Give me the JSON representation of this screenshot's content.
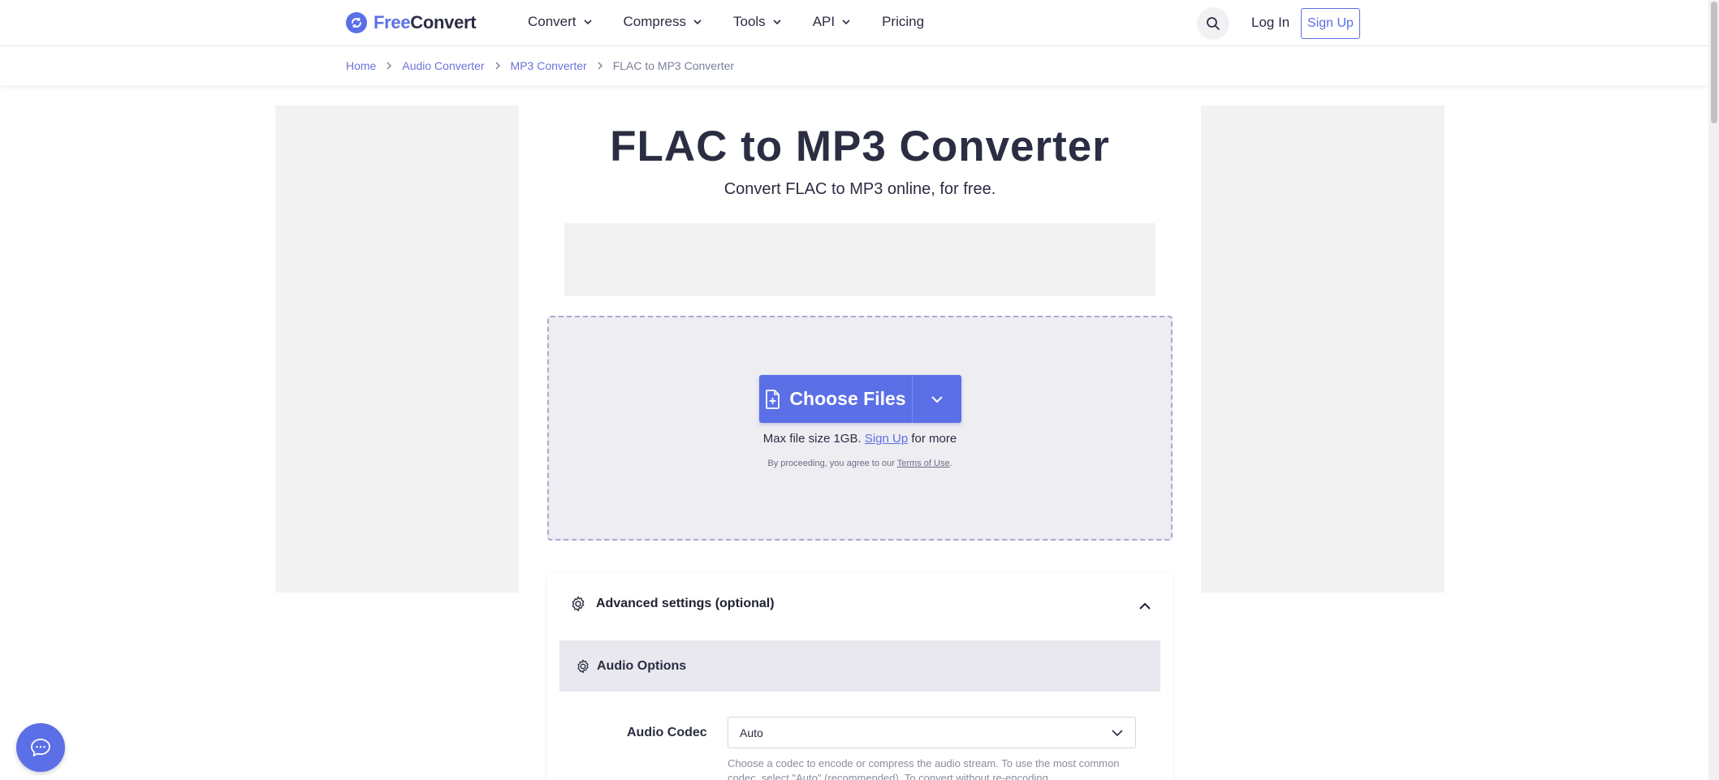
{
  "header": {
    "logo": {
      "part1": "Free",
      "part2": "Convert"
    },
    "nav": [
      {
        "label": "Convert",
        "has_dropdown": true
      },
      {
        "label": "Compress",
        "has_dropdown": true
      },
      {
        "label": "Tools",
        "has_dropdown": true
      },
      {
        "label": "API",
        "has_dropdown": true
      },
      {
        "label": "Pricing",
        "has_dropdown": false
      }
    ],
    "login_label": "Log In",
    "signup_label": "Sign Up"
  },
  "breadcrumb": [
    "Home",
    "Audio Converter",
    "MP3 Converter",
    "FLAC to MP3 Converter"
  ],
  "main": {
    "title": "FLAC to MP3 Converter",
    "subtitle": "Convert FLAC to MP3 online, for free."
  },
  "upload": {
    "choose_label": "Choose Files",
    "max_text": "Max file size 1GB.",
    "signup_link": "Sign Up",
    "max_suffix": "for more",
    "terms_prefix": "By proceeding, you agree to our",
    "terms_link": "Terms of Use",
    "terms_suffix": "."
  },
  "advanced": {
    "title": "Advanced settings (optional)",
    "section": "Audio Options",
    "codec_label": "Audio Codec",
    "codec_value": "Auto",
    "codec_help": "Choose a codec to encode or compress the audio stream. To use the most common codec, select \"Auto\" (recommended). To convert without re-encoding"
  },
  "colors": {
    "brand": "#5b6fe6",
    "text": "#2b2d42",
    "ad_bg": "#f2f2f2",
    "dropzone_bg": "#ededf2"
  }
}
